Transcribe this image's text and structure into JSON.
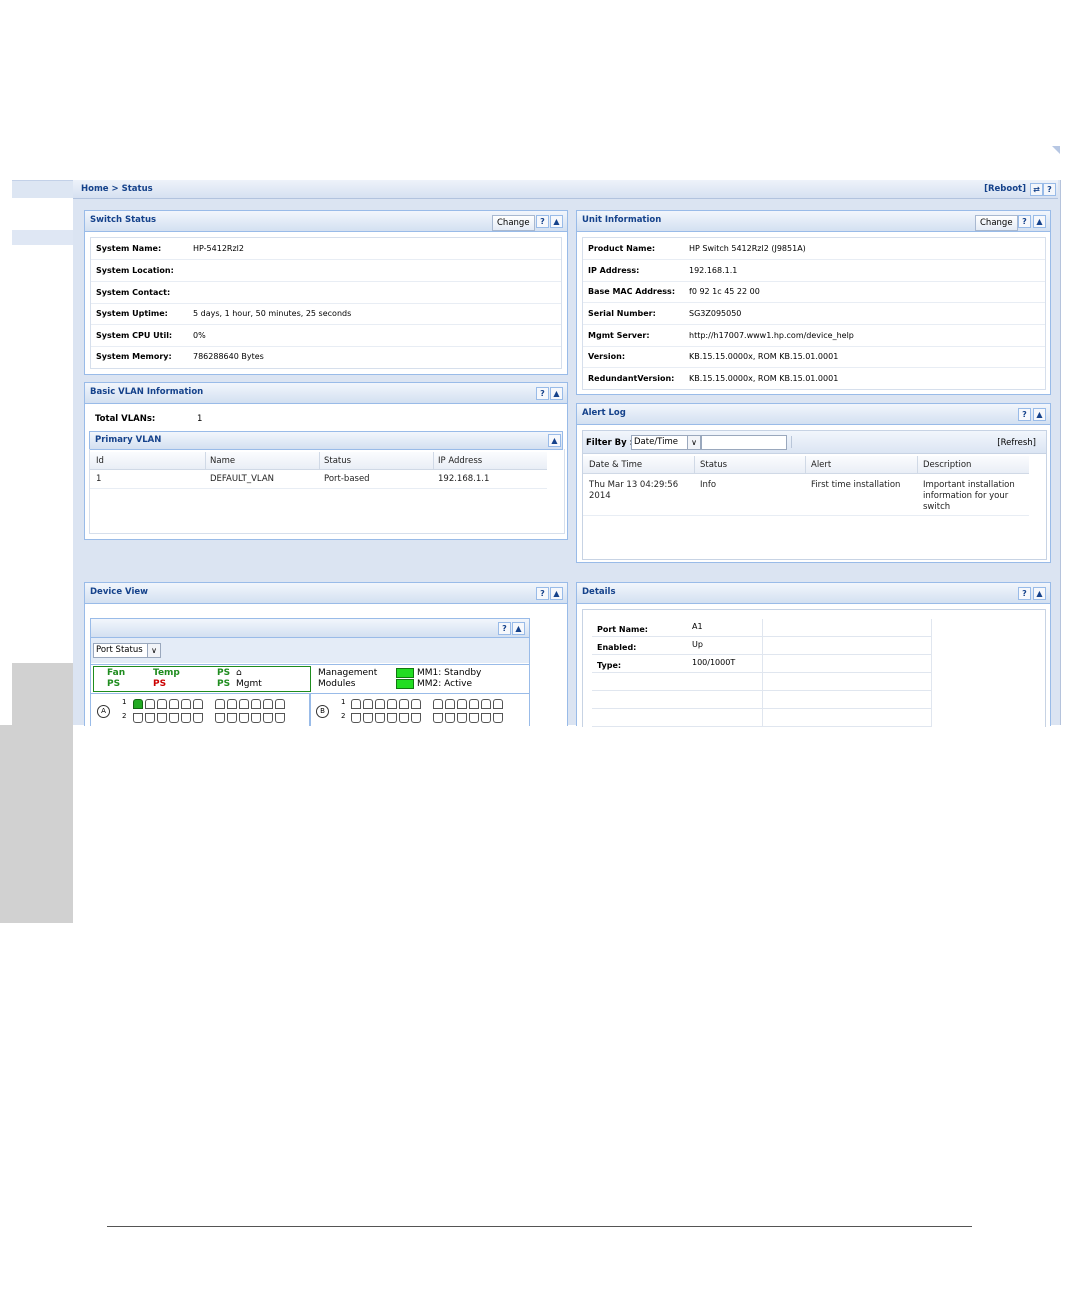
{
  "breadcrumb": "Home > Status",
  "reboot_label": "[Reboot]",
  "top_icons": {
    "refresh": "⇄",
    "help": "?"
  },
  "switch_status": {
    "title": "Switch Status",
    "change_label": "Change",
    "rows": [
      {
        "label": "System Name:",
        "value": "HP-5412Rzl2"
      },
      {
        "label": "System Location:",
        "value": ""
      },
      {
        "label": "System Contact:",
        "value": ""
      },
      {
        "label": "System Uptime:",
        "value": "5 days, 1 hour, 50 minutes, 25 seconds"
      },
      {
        "label": "System CPU Util:",
        "value": "0%"
      },
      {
        "label": "System Memory:",
        "value": "786288640 Bytes"
      }
    ]
  },
  "unit_info": {
    "title": "Unit Information",
    "change_label": "Change",
    "rows": [
      {
        "label": "Product Name:",
        "value": "HP Switch 5412Rzl2 (J9851A)"
      },
      {
        "label": "IP Address:",
        "value": "192.168.1.1"
      },
      {
        "label": "Base MAC Address:",
        "value": "f0 92 1c 45 22 00"
      },
      {
        "label": "Serial Number:",
        "value": "SG3Z095050"
      },
      {
        "label": "Mgmt Server:",
        "value": "http://h17007.www1.hp.com/device_help"
      },
      {
        "label": "Version:",
        "value": "KB.15.15.0000x, ROM KB.15.01.0001"
      },
      {
        "label": "RedundantVersion:",
        "value": "KB.15.15.0000x, ROM KB.15.01.0001"
      }
    ]
  },
  "vlan": {
    "title": "Basic VLAN Information",
    "total_label": "Total VLANs:",
    "total_value": "1",
    "primary_title": "Primary VLAN",
    "columns": [
      "Id",
      "Name",
      "Status",
      "IP Address"
    ],
    "rows": [
      [
        "1",
        "DEFAULT_VLAN",
        "Port-based",
        "192.168.1.1"
      ]
    ]
  },
  "alert_log": {
    "title": "Alert Log",
    "filter_label": "Filter By :",
    "filter_value": "Date/Time",
    "refresh_label": "[Refresh]",
    "columns": [
      "Date & Time",
      "Status",
      "Alert",
      "Description"
    ],
    "rows": [
      {
        "date": "Thu Mar 13 04:29:56 2014",
        "status": "Info",
        "alert": "First time installation",
        "description": "Important installation information for your switch"
      }
    ]
  },
  "device_view": {
    "title": "Device View",
    "select_value": "Port Status",
    "legend": {
      "fan": "Fan",
      "temp": "Temp",
      "ps1": "PS",
      "ps_top_right": "PS",
      "ps_green": "PS",
      "ps_red": "PS",
      "ps_bottom_right": "PS",
      "mgmt": "Mgmt",
      "mgmt_modules_1": "Management",
      "mgmt_modules_2": "Modules",
      "mm1": "MM1: Standby",
      "mm2": "MM2: Active"
    },
    "slot_a": "A",
    "slot_b": "B",
    "row1": "1",
    "row2": "2",
    "colors": {
      "up": "#22aa22",
      "ok": "#1e8c1e",
      "fault": "#cc0000"
    }
  },
  "details": {
    "title": "Details",
    "rows": [
      {
        "label": "Port Name:",
        "value": "A1"
      },
      {
        "label": "Enabled:",
        "value": "Up"
      },
      {
        "label": "Type:",
        "value": "100/1000T"
      }
    ]
  }
}
